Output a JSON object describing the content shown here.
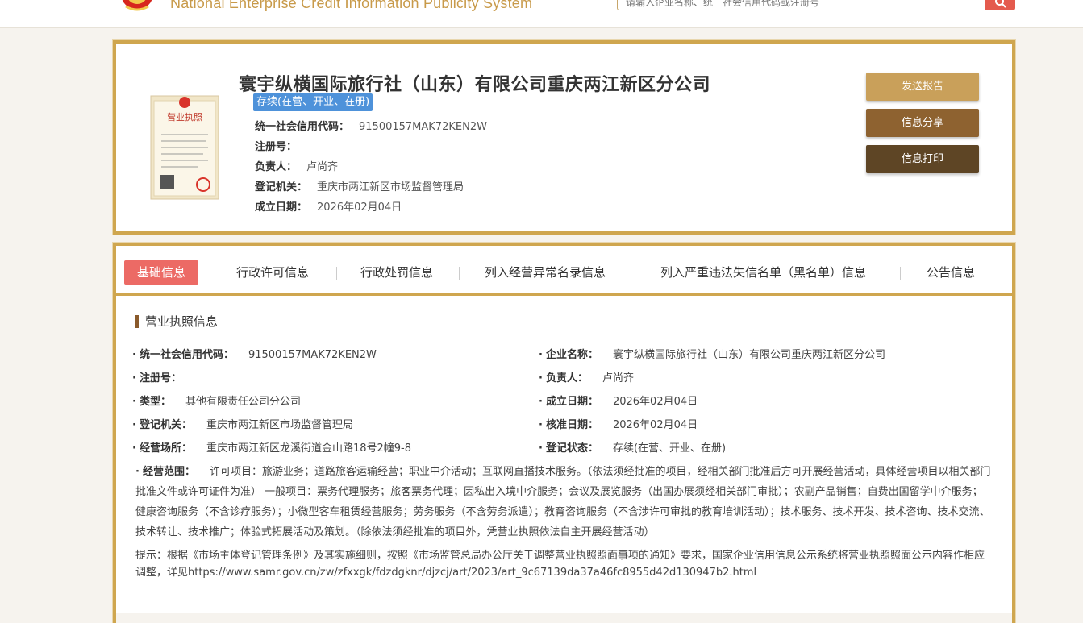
{
  "header": {
    "title": "National Enterprise Credit Information Publicity System",
    "search_placeholder": "请输入企业名称、统一社会信用代码或注册号"
  },
  "summary": {
    "company_name": "寰宇纵横国际旅行社（山东）有限公司重庆两江新区分公司",
    "status_tag": "存续(在营、开业、在册)",
    "fields": [
      {
        "label": "统一社会信用代码：",
        "value": "91500157MAK72KEN2W"
      },
      {
        "label": "注册号：",
        "value": ""
      },
      {
        "label": "负责人：",
        "value": "卢尚齐"
      },
      {
        "label": "登记机关：",
        "value": "重庆市两江新区市场监督管理局"
      },
      {
        "label": "成立日期：",
        "value": "2026年02月04日"
      }
    ],
    "buttons": {
      "send_report": "发送报告",
      "share": "信息分享",
      "print": "信息打印"
    }
  },
  "tabs": [
    {
      "label": "基础信息",
      "active": true
    },
    {
      "label": "行政许可信息",
      "active": false
    },
    {
      "label": "行政处罚信息",
      "active": false
    },
    {
      "label": "列入经营异常名录信息",
      "active": false
    },
    {
      "label": "列入严重违法失信名单（黑名单）信息",
      "active": false
    },
    {
      "label": "公告信息",
      "active": false
    }
  ],
  "license_section": {
    "title": "营业执照信息",
    "left": [
      {
        "label": "统一社会信用代码：",
        "value": "91500157MAK72KEN2W"
      },
      {
        "label": "注册号：",
        "value": ""
      },
      {
        "label": "类型：",
        "value": "其他有限责任公司分公司"
      },
      {
        "label": "登记机关：",
        "value": "重庆市两江新区市场监督管理局"
      },
      {
        "label": "经营场所：",
        "value": "重庆市两江新区龙溪街道金山路18号2幢9-8"
      }
    ],
    "right": [
      {
        "label": "企业名称：",
        "value": "寰宇纵横国际旅行社（山东）有限公司重庆两江新区分公司"
      },
      {
        "label": "负责人：",
        "value": "卢尚齐"
      },
      {
        "label": "成立日期：",
        "value": "2026年02月04日"
      },
      {
        "label": "核准日期：",
        "value": "2026年02月04日"
      },
      {
        "label": "登记状态：",
        "value": "存续(在营、开业、在册)"
      }
    ],
    "scope_label": "经营范围：",
    "scope_text": "许可项目：旅游业务；道路旅客运输经营；职业中介活动；互联网直播技术服务。（依法须经批准的项目，经相关部门批准后方可开展经营活动，具体经营项目以相关部门批准文件或许可证件为准） 一般项目：票务代理服务；旅客票务代理；因私出入境中介服务；会议及展览服务（出国办展须经相关部门审批）；农副产品销售；自费出国留学中介服务；健康咨询服务（不含诊疗服务）；小微型客车租赁经营服务；劳务服务（不含劳务派遣）；教育咨询服务（不含涉许可审批的教育培训活动）；技术服务、技术开发、技术咨询、技术交流、技术转让、技术推广；体验式拓展活动及策划。（除依法须经批准的项目外，凭营业执照依法自主开展经营活动）",
    "notice": "提示：根据《市场主体登记管理条例》及其实施细则，按照《市场监管总局办公厅关于调整营业执照照面事项的通知》要求，国家企业信用信息公示系统将营业执照照面公示内容作相应调整，详见https://www.samr.gov.cn/zw/zfxxgk/fdzdgknr/djzcj/art/2023/art_9c67139da37a46fc8955d42d130947b2.html"
  },
  "colors": {
    "gold_border": "#cfa64f",
    "status_blue": "#4e92da",
    "tab_active": "#ec6a65",
    "btn_report": "#c9a05a",
    "btn_share": "#8e6230",
    "btn_print": "#5e4525"
  }
}
